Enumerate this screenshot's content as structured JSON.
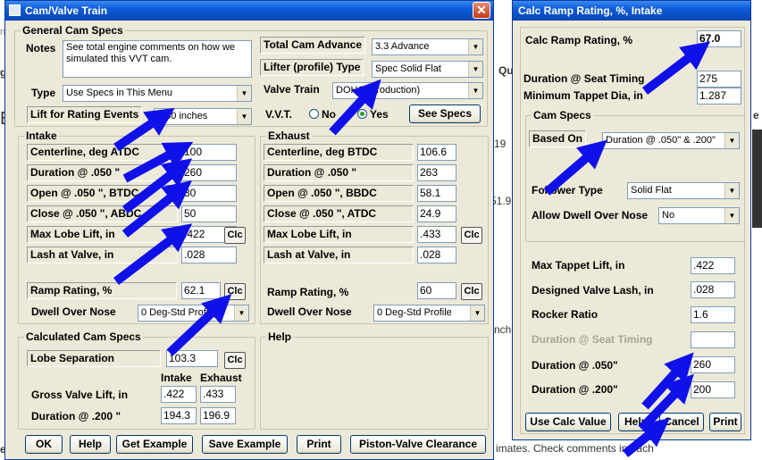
{
  "background": {
    "left_labels": [
      "ne",
      "gi",
      "E",
      "el"
    ],
    "right_labels": [
      "Qu",
      "19",
      "51.9",
      "nch"
    ],
    "status_text": "imates.  Check comments in each",
    "right_edge": [
      "e"
    ]
  },
  "cam": {
    "title": "Cam/Valve Train",
    "general": {
      "legend": "General Cam Specs",
      "notes_label": "Notes",
      "notes_text": "See total engine comments on how we simulated this VVT cam.",
      "type_label": "Type",
      "type_value": "Use Specs in This Menu",
      "lift_label": "Lift for Rating Events",
      "lift_value": ".050 inches",
      "tca_label": "Total Cam Advance",
      "tca_value": "3.3 Advance",
      "lifter_label": "Lifter (profile) Type",
      "lifter_value": "Spec Solid Flat",
      "valvetrain_label": "Valve Train",
      "valvetrain_value": "DOHC (production)",
      "vvt_label": "V.V.T.",
      "vvt_no": "No",
      "vvt_yes": "Yes",
      "see_specs": "See Specs"
    },
    "intake": {
      "legend": "Intake",
      "rows": [
        {
          "label": "Centerline, deg ATDC",
          "value": "100"
        },
        {
          "label": "Duration @ .050 \"",
          "value": "260"
        },
        {
          "label": "Open @ .050 \", BTDC",
          "value": "30"
        },
        {
          "label": "Close @ .050 \", ABDC",
          "value": "50"
        },
        {
          "label": "Max Lobe Lift, in",
          "value": ".422"
        },
        {
          "label": "Lash at Valve, in",
          "value": ".028"
        }
      ],
      "ramp_label": "Ramp Rating, %",
      "ramp_value": "62.1",
      "dwell_label": "Dwell Over Nose",
      "dwell_value": "0 Deg-Std Profile"
    },
    "exhaust": {
      "legend": "Exhaust",
      "rows": [
        {
          "label": "Centerline, deg BTDC",
          "value": "106.6"
        },
        {
          "label": "Duration @ .050 \"",
          "value": "263"
        },
        {
          "label": "Open @ .050 \", BBDC",
          "value": "58.1"
        },
        {
          "label": "Close @ .050 \", ATDC",
          "value": "24.9"
        },
        {
          "label": "Max Lobe Lift, in",
          "value": ".433"
        },
        {
          "label": "Lash at Valve, in",
          "value": ".028"
        }
      ],
      "ramp_label": "Ramp Rating, %",
      "ramp_value": "60",
      "dwell_label": "Dwell Over Nose",
      "dwell_value": "0 Deg-Std Profile"
    },
    "calc": {
      "legend": "Calculated Cam Specs",
      "lobe_label": "Lobe Separation",
      "lobe_value": "103.3",
      "col_intake": "Intake",
      "col_exhaust": "Exhaust",
      "gross_label": "Gross Valve Lift, in",
      "gross_intake": ".422",
      "gross_exhaust": ".433",
      "dur200_label": "Duration @ .200 \"",
      "dur200_intake": "194.3",
      "dur200_exhaust": "196.9"
    },
    "help_legend": "Help",
    "clc": "Clc",
    "buttons": {
      "ok": "OK",
      "help": "Help",
      "get_example": "Get Example",
      "save_example": "Save Example",
      "print": "Print",
      "piston": "Piston-Valve Clearance"
    }
  },
  "ramp": {
    "title": "Calc Ramp Rating, %, Intake",
    "calc_label": "Calc Ramp Rating, %",
    "calc_value": "67.0",
    "seat_label": "Duration @ Seat Timing",
    "seat_value": "275",
    "tappet_label": "Minimum Tappet Dia, in",
    "tappet_value": "1.287",
    "specs_legend": "Cam Specs",
    "based_label": "Based On",
    "based_value": "Duration @ .050\" & .200\"",
    "follower_label": "Follower Type",
    "follower_value": "Solid Flat",
    "dwell_label": "Allow Dwell Over Nose",
    "dwell_value": "No",
    "maxtap_label": "Max Tappet Lift, in",
    "maxtap_value": ".422",
    "lash_label": "Designed Valve Lash, in",
    "lash_value": ".028",
    "rocker_label": "Rocker Ratio",
    "rocker_value": "1.6",
    "seat2_label": "Duration @ Seat Timing",
    "seat2_value": "",
    "d050_label": "Duration @ .050\"",
    "d050_value": "260",
    "d200_label": "Duration @ .200\"",
    "d200_value": "200",
    "buttons": {
      "use": "Use Calc Value",
      "help": "Help",
      "cancel": "Cancel",
      "print": "Print"
    }
  },
  "colors": {
    "titlebar": "#0d5bd8",
    "window": "#ece9d8",
    "arrow": "#1010e8"
  }
}
